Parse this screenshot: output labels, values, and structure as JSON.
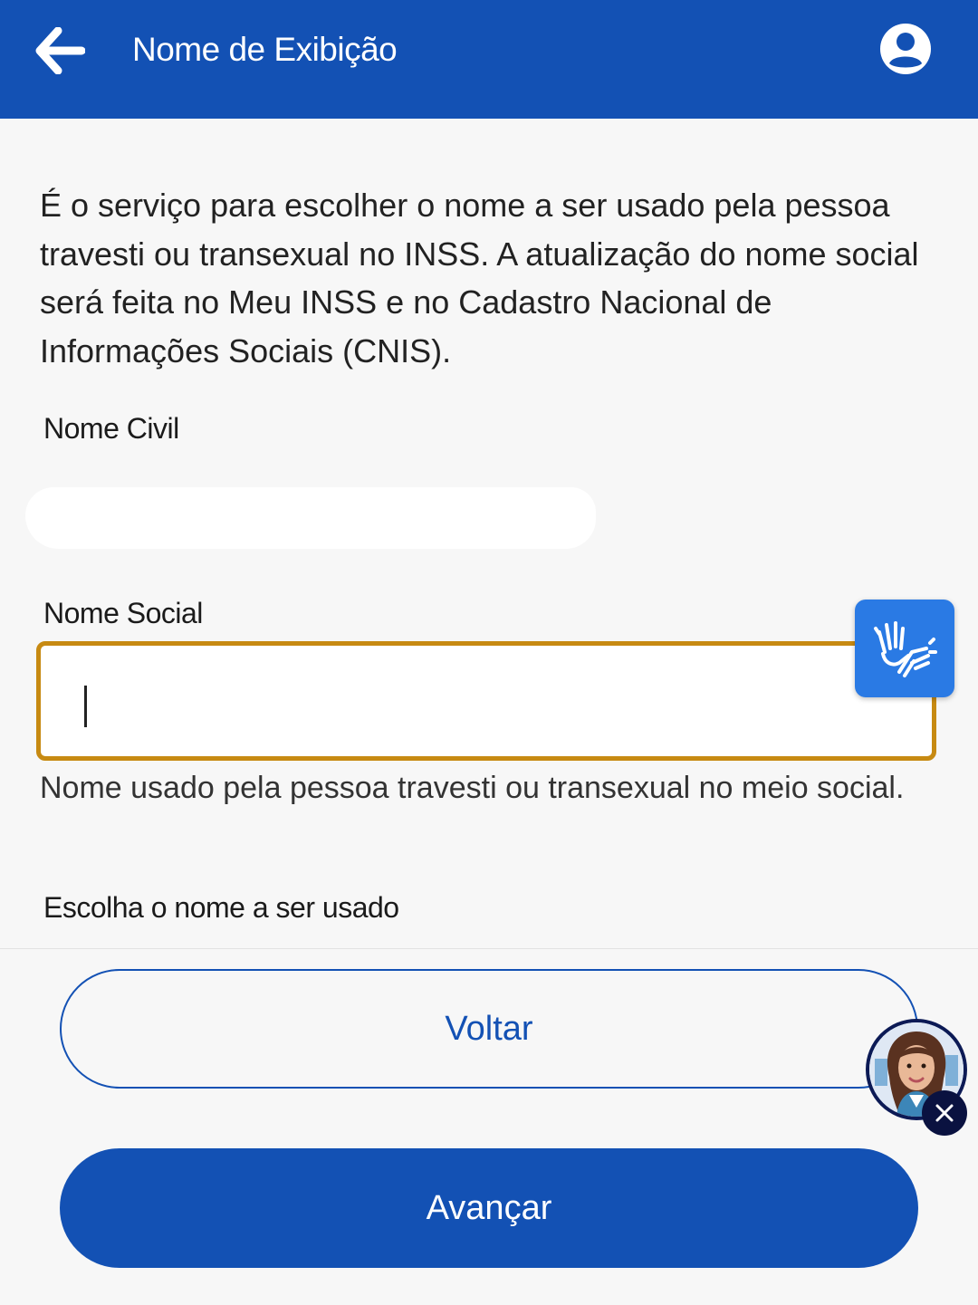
{
  "header": {
    "title": "Nome de Exibição",
    "back_icon": "arrow-left-icon",
    "account_icon": "user-circle-icon",
    "background": "#1351b4"
  },
  "content": {
    "description": "É o serviço para escolher o nome a ser usado pela pessoa travesti ou transexual no INSS. A atualização do nome social será feita no Meu INSS e no Cadastro Nacional de Informações Sociais (CNIS).",
    "civil_name_label": "Nome Civil",
    "social_name_label": "Nome Social",
    "social_name_value": "",
    "social_name_helper": "Nome usado pela pessoa travesti ou transexual no meio social.",
    "choose_name_label": "Escolha o nome a ser usado"
  },
  "accessibility": {
    "libras_icon": "sign-language-hands-icon"
  },
  "footer": {
    "back_label": "Voltar",
    "next_label": "Avançar"
  },
  "assistant": {
    "avatar_icon": "virtual-assistant-avatar",
    "close_icon": "close-icon"
  },
  "colors": {
    "primary": "#1351b4",
    "focus_border": "#c78a12",
    "libras_button": "#2a7ae4"
  }
}
